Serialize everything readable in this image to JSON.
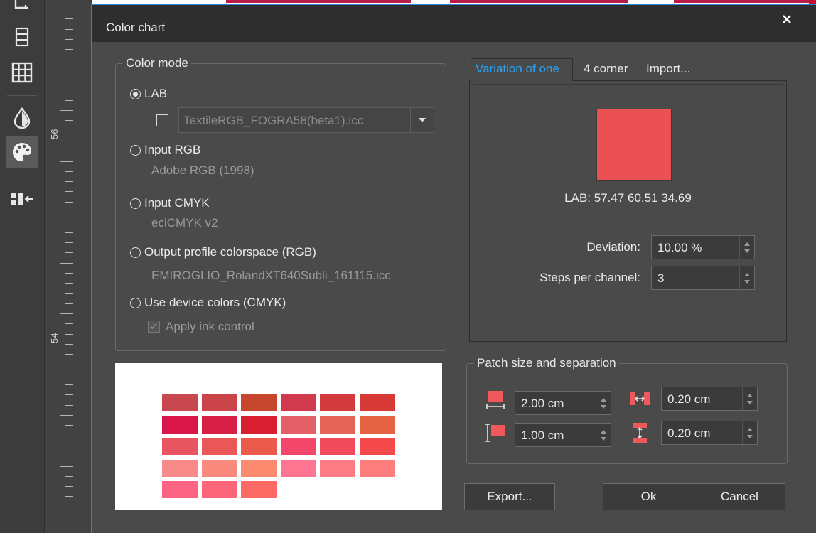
{
  "ruler": {
    "label_top": "56",
    "label_bottom": "54"
  },
  "dialog": {
    "title": "Color chart",
    "close_label": "×"
  },
  "color_mode": {
    "legend": "Color mode",
    "lab": {
      "label": "LAB",
      "checked": true
    },
    "profile_combo": {
      "value": "TextileRGB_FOGRA58(beta1).icc"
    },
    "input_rgb": {
      "label": "Input RGB",
      "sub": "Adobe RGB (1998)"
    },
    "input_cmyk": {
      "label": "Input CMYK",
      "sub": "eciCMYK v2"
    },
    "output_profile": {
      "label": "Output profile colorspace (RGB)",
      "sub": "EMIROGLIO_RolandXT640Subli_161115.icc"
    },
    "device_colors": {
      "label": "Use device colors (CMYK)"
    },
    "apply_ink": {
      "label": "Apply ink control",
      "checkmark": "✓"
    }
  },
  "tabs": [
    {
      "label": "Variation of one",
      "active": true
    },
    {
      "label": "4 corner"
    },
    {
      "label": "Import..."
    }
  ],
  "variation": {
    "color": "#eb5054",
    "lab_text": "LAB: 57.47 60.51 34.69",
    "deviation_label": "Deviation:",
    "deviation_value": "10.00 %",
    "steps_label": "Steps per channel:",
    "steps_value": "3"
  },
  "patch": {
    "legend": "Patch size and separation",
    "width_value": "2.00 cm",
    "height_value": "1.00 cm",
    "h_separation_value": "0.20 cm",
    "v_separation_value": "0.20 cm"
  },
  "preview_swatches": [
    [
      "#c84850",
      "#cb4449",
      "#c7472e",
      "#d03a4c",
      "#d33a3e",
      "#d73a36"
    ],
    [
      "#d8164a",
      "#d91f45",
      "#da1f32",
      "#e36068",
      "#e56459",
      "#e56342"
    ],
    [
      "#e75560",
      "#ea5758",
      "#ec5a4c",
      "#f2466a",
      "#f24a5d",
      "#f44a4b"
    ],
    [
      "#f98a8a",
      "#fb8a7e",
      "#fc8a6e",
      "#fd7591",
      "#fd7b85",
      "#fd7e7c"
    ],
    [
      "#fd6483",
      "#fd6678",
      "#fd6a65"
    ]
  ],
  "buttons": {
    "export": "Export...",
    "ok": "Ok",
    "cancel": "Cancel"
  }
}
